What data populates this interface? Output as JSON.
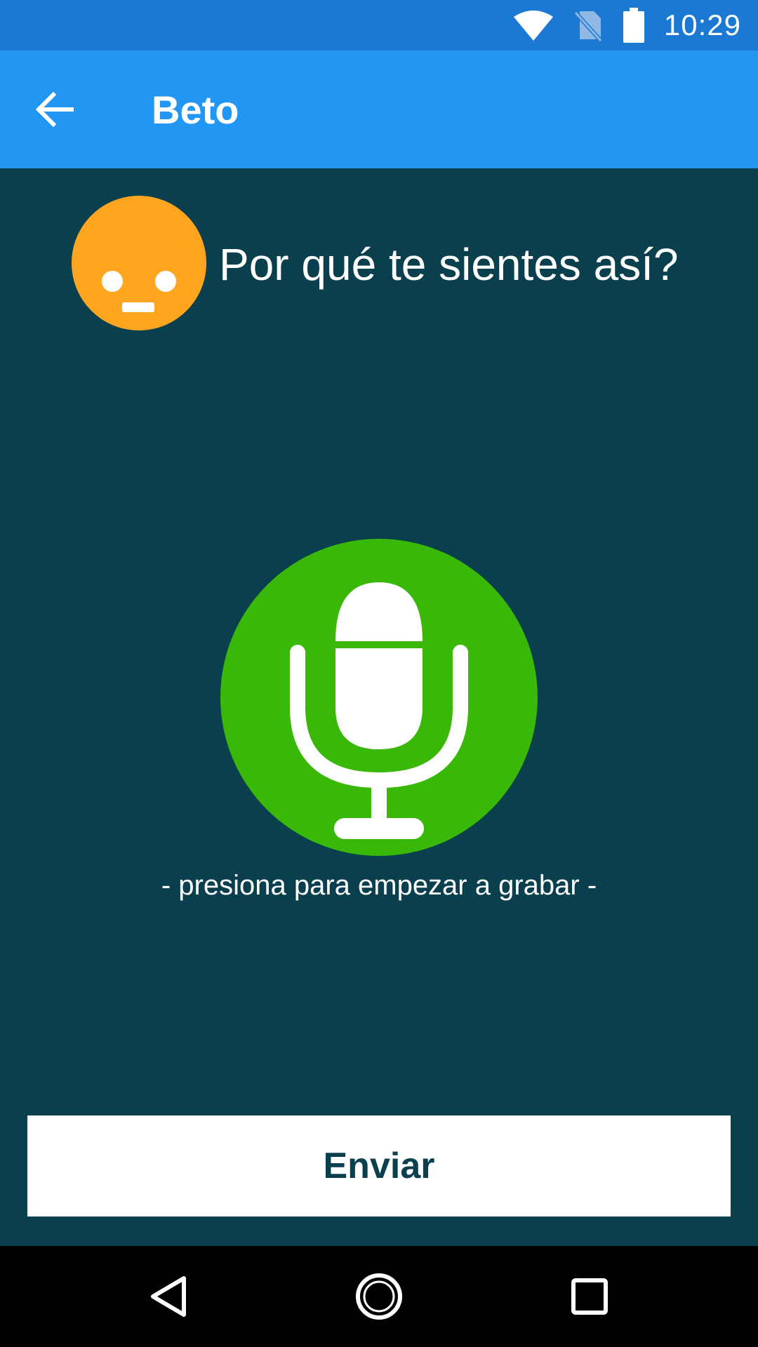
{
  "status_bar": {
    "time": "10:29",
    "icons": [
      "wifi-icon",
      "no-sim-icon",
      "battery-icon"
    ]
  },
  "app_bar": {
    "title": "Beto",
    "back_icon": "arrow-back-icon"
  },
  "question": {
    "text": "Por qué te sientes así?",
    "mood_icon": "neutral-face-icon",
    "mood_color": "#ffa520"
  },
  "recorder": {
    "mic_icon": "microphone-icon",
    "mic_color": "#39b807",
    "hint": "- presiona para empezar a grabar -"
  },
  "send_button": {
    "label": "Enviar"
  },
  "nav_bar": {
    "items": [
      "back-triangle-icon",
      "home-circle-icon",
      "recents-square-icon"
    ]
  },
  "colors": {
    "status_bar": "#1b78d3",
    "app_bar": "#2196f3",
    "background": "#0a3f4e"
  }
}
